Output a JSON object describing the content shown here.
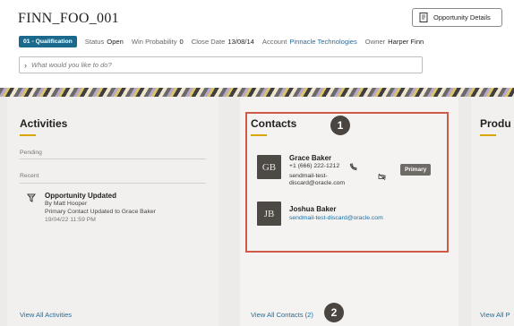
{
  "header": {
    "title": "FINN_FOO_001",
    "opportunity_details_label": "Opportunity Details",
    "stage_badge": "01 - Qualification",
    "status_key": "Status",
    "status_value": "Open",
    "win_probability_key": "Win Probability",
    "win_probability_value": "0",
    "close_date_key": "Close Date",
    "close_date_value": "13/08/14",
    "account_key": "Account",
    "account_value": "Pinnacle Technologies",
    "owner_key": "Owner",
    "owner_value": "Harper Finn",
    "ask_placeholder": "What would you like to do?"
  },
  "activities": {
    "heading": "Activities",
    "pending_label": "Pending",
    "recent_label": "Recent",
    "item": {
      "title": "Opportunity Updated",
      "by": "By Matt Hooper",
      "desc": "Primary Contact Updated to Grace Baker",
      "time": "19/04/22 11:59 PM"
    },
    "view_all": "View All Activities"
  },
  "contacts": {
    "heading": "Contacts",
    "items": [
      {
        "initials": "GB",
        "name": "Grace Baker",
        "phone": "+1 (666) 222-1212",
        "email_line1": "sendmail-test-",
        "email_line2": "discard@oracle.com",
        "primary_label": "Primary"
      },
      {
        "initials": "JB",
        "name": "Joshua Baker",
        "email": "sendmail-test-discard@oracle.com"
      }
    ],
    "view_all": "View All Contacts (2)"
  },
  "products": {
    "heading_partial": "Produ",
    "view_all_partial": "View All P"
  },
  "callouts": {
    "one": "1",
    "two": "2"
  },
  "colors": {
    "badge": "#1b6a8e",
    "link": "#1d6fa5",
    "accent_underline": "#d9a500",
    "highlight_box": "#d05a4a"
  }
}
